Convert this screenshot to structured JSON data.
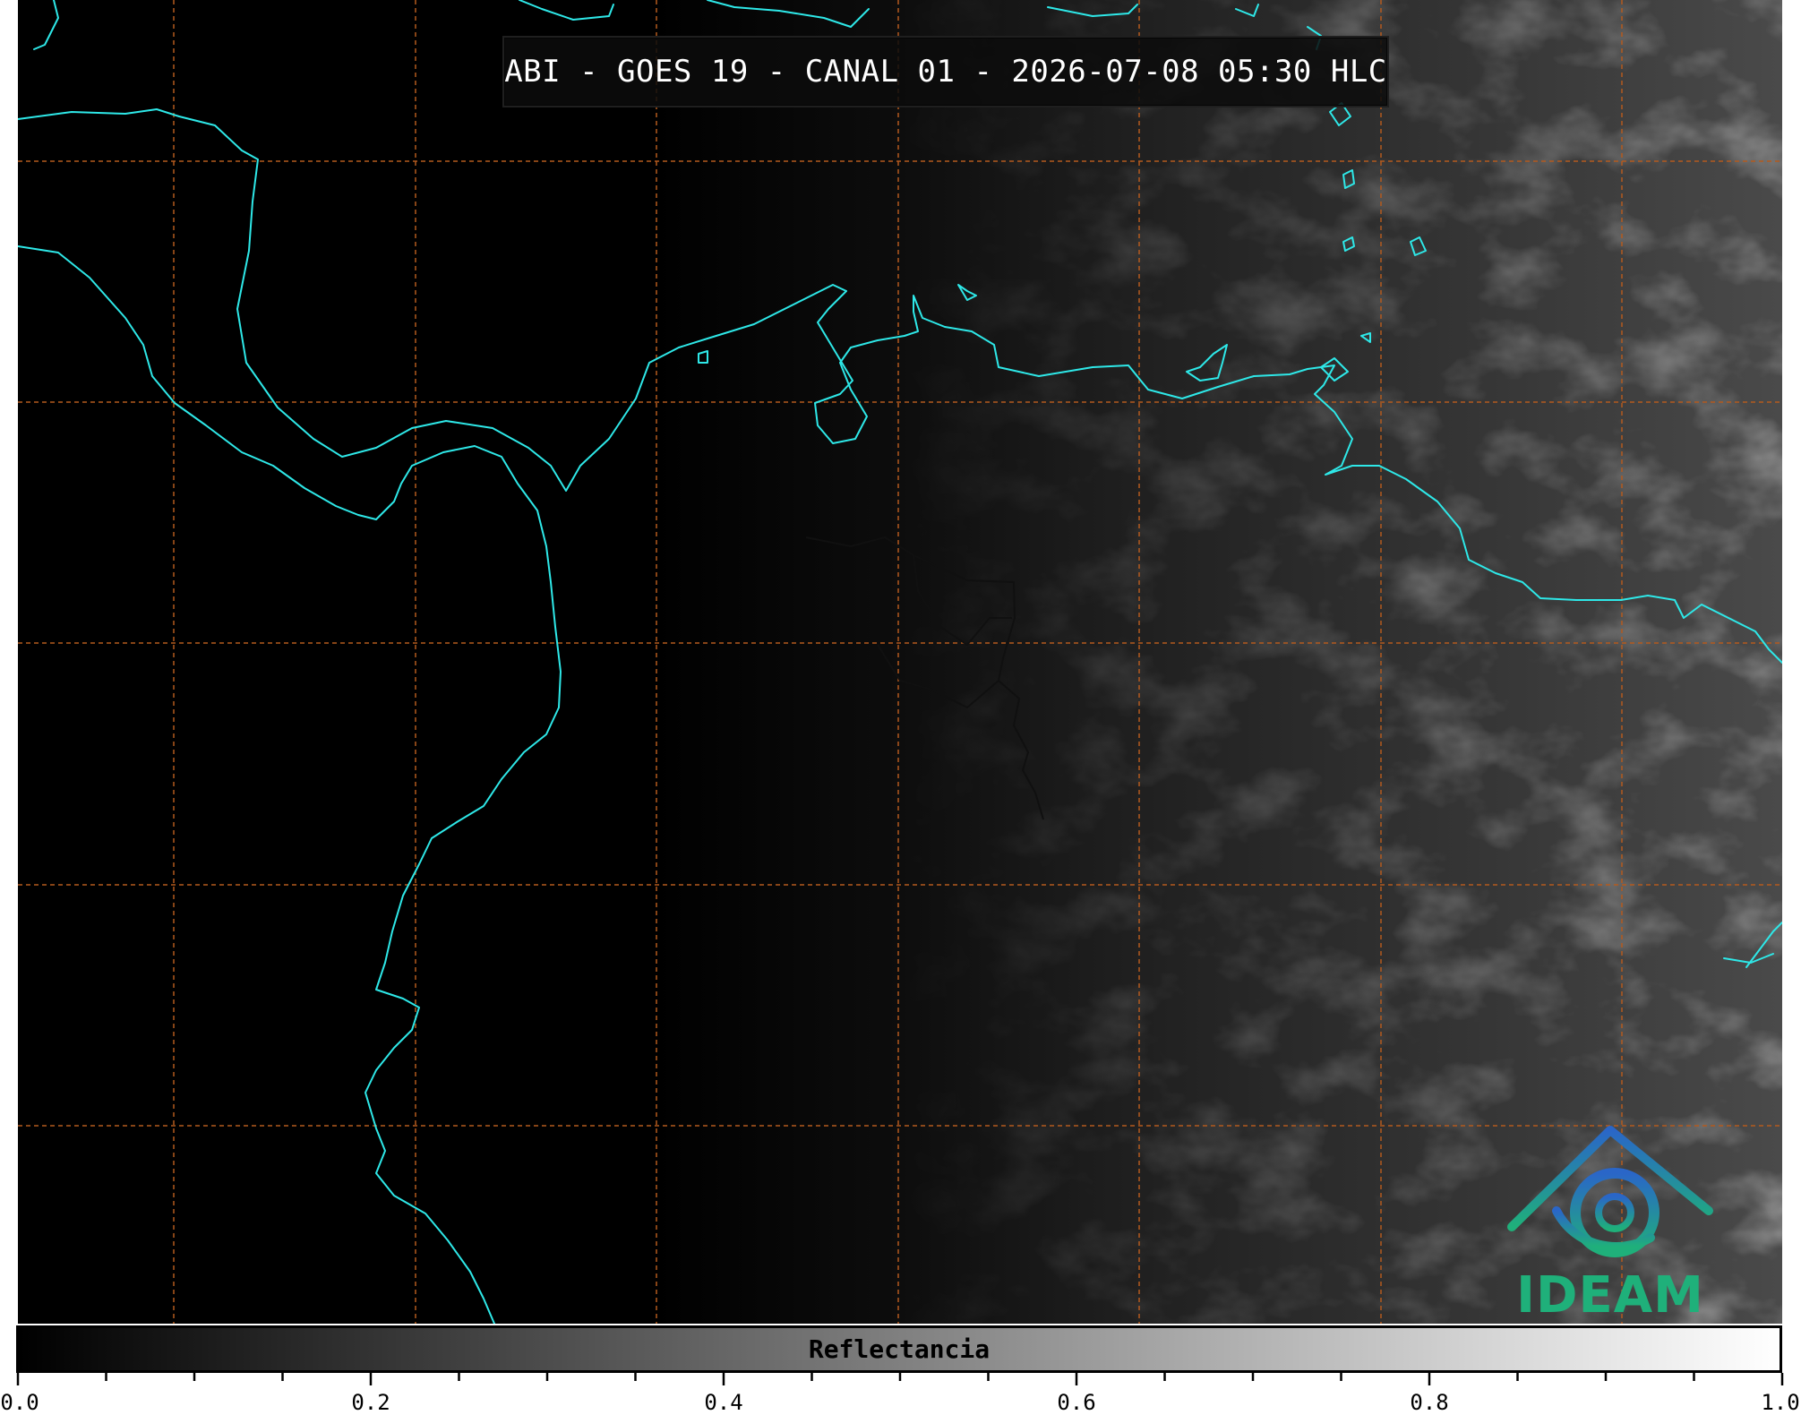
{
  "title": "ABI - GOES 19 - CANAL 01 - 2026-07-08 05:30 HLC",
  "logo": {
    "icon": "ideam-logo-icon",
    "text": "IDEAM"
  },
  "colorbar": {
    "label": "Reflectancia",
    "min": 0.0,
    "max": 1.0,
    "ticks": [
      "0.0",
      "0.2",
      "0.4",
      "0.6",
      "0.8",
      "1.0"
    ],
    "minor_step": 0.05,
    "color_low": "#000000",
    "color_high": "#ffffff"
  },
  "map": {
    "colors": {
      "coastline": "#2ee8e8",
      "graticule": "#b45a1e",
      "borders": "#101010"
    },
    "graticule_style": "dashed"
  }
}
